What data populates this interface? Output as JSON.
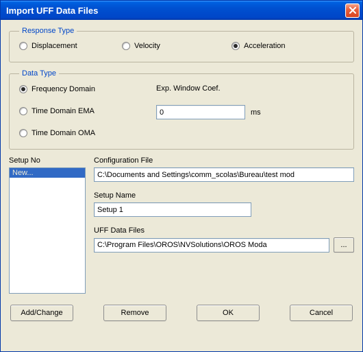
{
  "window": {
    "title": "Import UFF Data Files"
  },
  "response_type": {
    "legend": "Response Type",
    "displacement": "Displacement",
    "velocity": "Velocity",
    "acceleration": "Acceleration",
    "selected": "acceleration"
  },
  "data_type": {
    "legend": "Data Type",
    "frequency_domain": "Frequency Domain",
    "time_domain_ema": "Time Domain EMA",
    "time_domain_oma": "Time Domain OMA",
    "selected": "frequency_domain",
    "coef_label": "Exp. Window Coef.",
    "coef_value": "0",
    "coef_unit": "ms"
  },
  "setup": {
    "list_label": "Setup No",
    "items": [
      "New..."
    ],
    "selected_index": 0,
    "config_file_label": "Configuration File",
    "config_file_value": "C:\\Documents and Settings\\comm_scolas\\Bureau\\test mod",
    "setup_name_label": "Setup Name",
    "setup_name_value": "Setup 1",
    "uff_label": "UFF Data Files",
    "uff_value": "C:\\Program Files\\OROS\\NVSolutions\\OROS Moda",
    "browse_label": "..."
  },
  "buttons": {
    "add_change": "Add/Change",
    "remove": "Remove",
    "ok": "OK",
    "cancel": "Cancel"
  }
}
